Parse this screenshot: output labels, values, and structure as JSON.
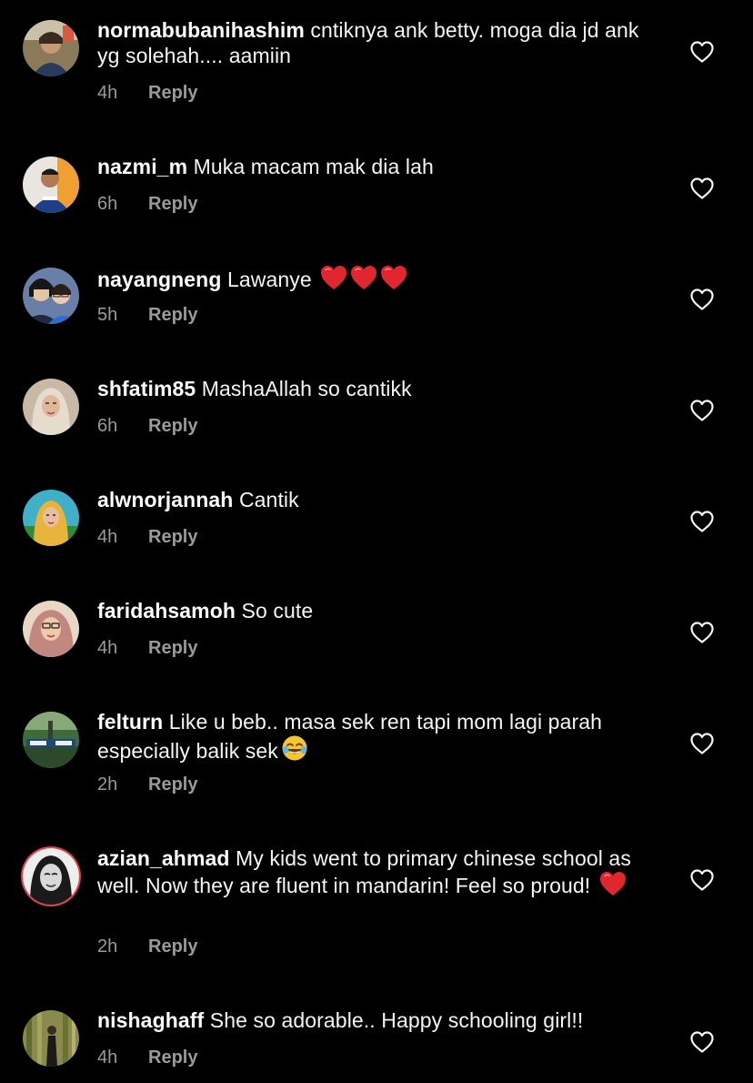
{
  "icons": {
    "like": "heart-outline-icon",
    "heart_emoji": "red-heart-emoji",
    "laugh_emoji": "tears-of-joy-emoji"
  },
  "colors": {
    "background": "#000000",
    "text": "#f5f5f5",
    "muted": "#9a9a9a",
    "heart": "#e0262f"
  },
  "comments": [
    {
      "username": "normabubanihashim",
      "text": "cntiknya ank betty. moga dia jd ank yg solehah.... aamiin",
      "time": "4h",
      "reply_label": "Reply"
    },
    {
      "username": "nazmi_m",
      "text": "Muka macam mak dia lah",
      "time": "6h",
      "reply_label": "Reply"
    },
    {
      "username": "nayangneng",
      "text": "Lawanye",
      "time": "5h",
      "reply_label": "Reply"
    },
    {
      "username": "shfatim85",
      "text": "MashaAllah so cantikk",
      "time": "6h",
      "reply_label": "Reply"
    },
    {
      "username": "alwnorjannah",
      "text": "Cantik",
      "time": "4h",
      "reply_label": "Reply"
    },
    {
      "username": "faridahsamoh",
      "text": "So cute",
      "time": "4h",
      "reply_label": "Reply"
    },
    {
      "username": "felturn",
      "text": "Like u beb.. masa sek ren tapi mom lagi parah especially balik sek",
      "time": "2h",
      "reply_label": "Reply"
    },
    {
      "username": "azian_ahmad",
      "text": "My kids went to primary chinese school as well. Now they are fluent in mandarin! Feel so proud!",
      "time": "2h",
      "reply_label": "Reply"
    },
    {
      "username": "nishaghaff",
      "text": "She so adorable.. Happy schooling girl!!",
      "time": "4h",
      "reply_label": "Reply"
    }
  ]
}
